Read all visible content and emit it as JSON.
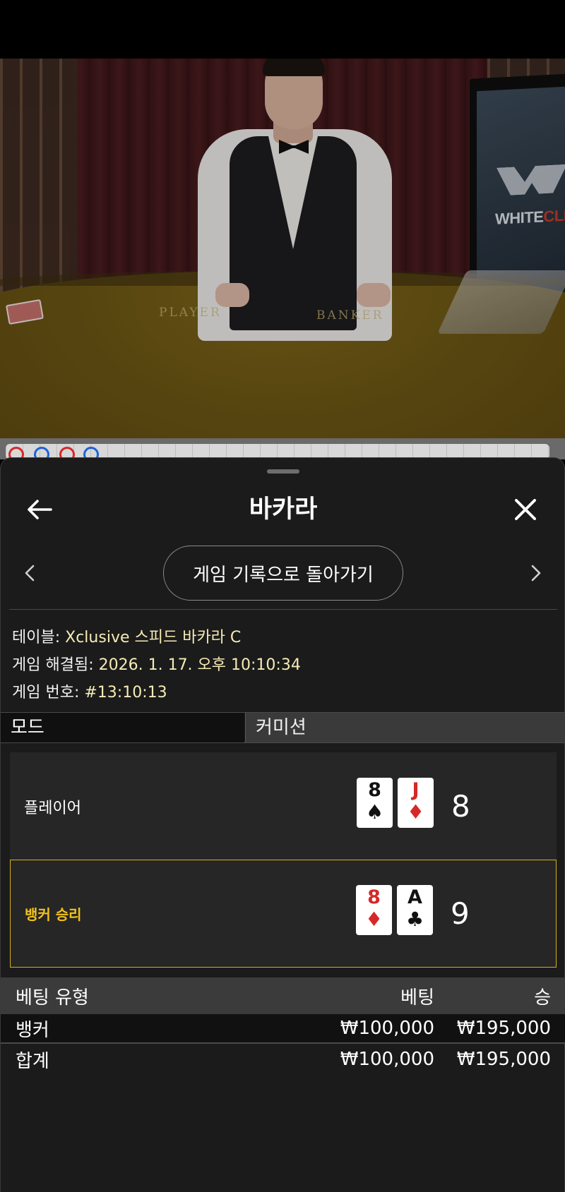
{
  "header": {
    "title": "바카라",
    "back_icon": "arrow-left-icon",
    "close_icon": "close-icon"
  },
  "navigation": {
    "back_to_history_label": "게임 기록으로 돌아가기",
    "prev_icon": "chevron-left-icon",
    "next_icon": "chevron-right-icon"
  },
  "video": {
    "brand_text_main": "WHITE",
    "brand_text_accent": "CLIFF",
    "table_left_word": "PLAYER",
    "table_right_word": "BANKER"
  },
  "game_info": {
    "table_label": "테이블:",
    "table_value": "Xclusive 스피드 바카라 C",
    "resolved_label": "게임 해결됨:",
    "resolved_value": "2026. 1. 17. 오후 10:10:34",
    "number_label": "게임 번호:",
    "number_value": "#13:10:13"
  },
  "tabs": {
    "mode": "모드",
    "commission": "커미션"
  },
  "results": {
    "player": {
      "label": "플레이어",
      "cards": [
        {
          "rank": "8",
          "suit": "♠",
          "color": "black"
        },
        {
          "rank": "J",
          "suit": "♦",
          "color": "red"
        }
      ],
      "score": "8"
    },
    "banker": {
      "label": "뱅커 승리",
      "cards": [
        {
          "rank": "8",
          "suit": "♦",
          "color": "red"
        },
        {
          "rank": "A",
          "suit": "♣",
          "color": "black"
        }
      ],
      "score": "9"
    }
  },
  "bets": {
    "headers": {
      "type": "베팅 유형",
      "bet": "베팅",
      "win": "승"
    },
    "rows": [
      {
        "type": "뱅커",
        "bet": "₩100,000",
        "win": "₩195,000"
      }
    ],
    "total": {
      "type": "합계",
      "bet": "₩100,000",
      "win": "₩195,000"
    }
  },
  "colors": {
    "accent_gold": "#d4b020",
    "win_text": "#f2c21a",
    "value_text": "#f6ebb6",
    "sheet_bg": "#1b1b1b"
  }
}
